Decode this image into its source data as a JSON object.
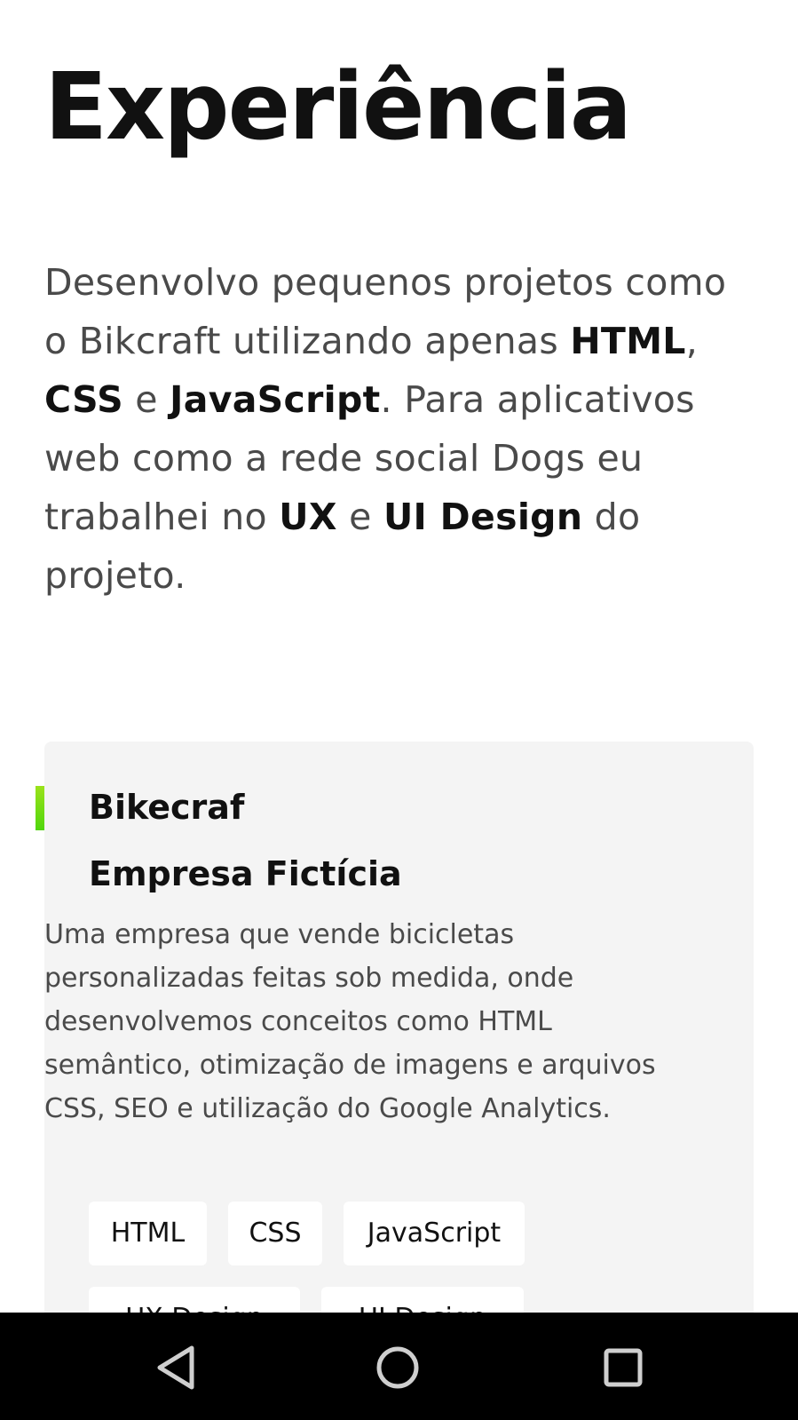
{
  "section": {
    "title": "Experiência",
    "intro": [
      {
        "text": "Desenvolvo pequenos projetos como o Bikcraft utilizando apenas ",
        "bold": false
      },
      {
        "text": "HTML",
        "bold": true
      },
      {
        "text": ", ",
        "bold": false
      },
      {
        "text": "CSS",
        "bold": true
      },
      {
        "text": " e ",
        "bold": false
      },
      {
        "text": "JavaScript",
        "bold": true
      },
      {
        "text": ". Para aplicativos web como a rede social Dogs eu trabalhei no ",
        "bold": false
      },
      {
        "text": "UX",
        "bold": true
      },
      {
        "text": " e ",
        "bold": false
      },
      {
        "text": "UI Design",
        "bold": true
      },
      {
        "text": " do projeto.",
        "bold": false
      }
    ]
  },
  "card": {
    "title": "Bikecraf",
    "subtitle": "Empresa Fictícia",
    "description": "Uma empresa que vende bicicletas personalizadas feitas sob medida, onde desenvolvemos conceitos como HTML semântico, otimização de imagens e arquivos CSS, SEO e utilização do Google Analytics.",
    "tags": [
      "HTML",
      "CSS",
      "JavaScript",
      "UX Design",
      "UI Design"
    ],
    "accent_gradient": [
      "#9be21b",
      "#4fd60c"
    ]
  },
  "nav": {
    "icons": [
      "back-icon",
      "home-icon",
      "recents-icon"
    ],
    "icon_color": "#cfcfcf"
  }
}
